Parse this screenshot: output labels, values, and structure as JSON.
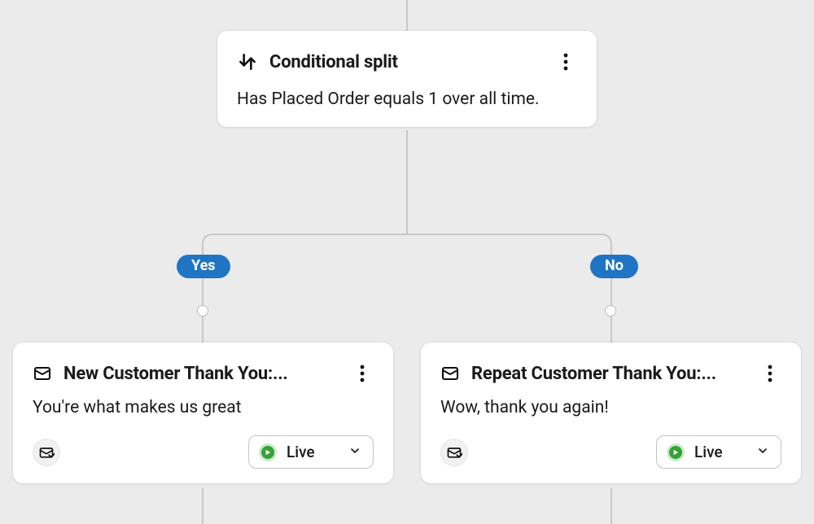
{
  "split": {
    "title": "Conditional split",
    "condition": "Has Placed Order equals 1 over all time."
  },
  "branches": {
    "yes": {
      "pill": "Yes",
      "title": "New Customer Thank You:...",
      "subject": "You're what makes us great",
      "status": "Live"
    },
    "no": {
      "pill": "No",
      "title": "Repeat Customer Thank You:...",
      "subject": "Wow, thank you again!",
      "status": "Live"
    }
  },
  "colors": {
    "pill": "#1f74c4",
    "status_green": "#34a135"
  }
}
